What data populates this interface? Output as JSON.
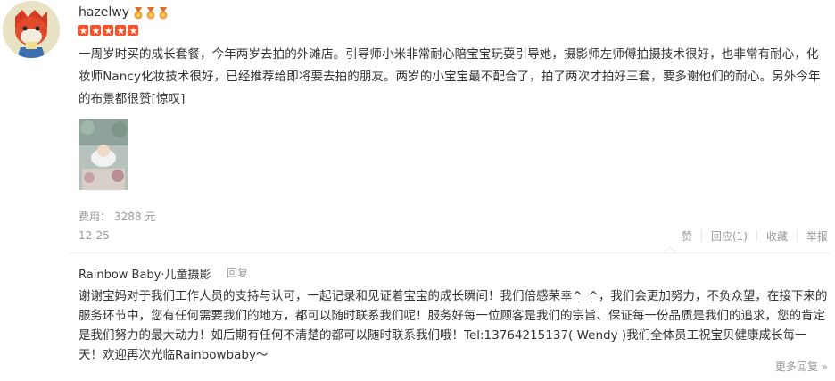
{
  "review": {
    "username": "hazelwy",
    "text": "一周岁时买的成长套餐，今年两岁去拍的外滩店。引导师小米非常耐心陪宝宝玩耍引导她，摄影师左师傅拍摄技术很好，也非常有耐心，化妆师Nancy化妆技术很好，已经推荐给即将要去拍的朋友。两岁的小宝宝最不配合了，拍了两次才拍好三套，要多谢他们的耐心。另外今年的布景都很赞[惊叹]",
    "price_label": "费用：",
    "price_value": "3288 元",
    "date": "12-25",
    "rating_stars": 5,
    "medal_count": 3
  },
  "actions": {
    "like": "赞",
    "reply": "回应(1)",
    "favorite": "收藏",
    "report": "举报"
  },
  "reply": {
    "author": "Rainbow Baby·儿童摄影",
    "tag": "回复",
    "text": "谢谢宝妈对于我们工作人员的支持与认可，一起记录和见证着宝宝的成长瞬间！我们倍感荣幸^_^，我们会更加努力，不负众望，在接下来的服务环节中，您有任何需要我们的地方，都可以随时联系我们呢！服务好每一位顾客是我们的宗旨、保证每一份品质是我们的追求，您的肯定是我们努力的最大动力！如后期有任何不清楚的都可以随时联系我们哦！Tel:13764215137( Wendy )我们全体员工祝宝贝健康成长每一天！欢迎再次光临Rainbowbaby～",
    "more": "更多回复 »"
  },
  "colors": {
    "star": "#f5522d",
    "medal": "#f0a030",
    "muted": "#999999"
  }
}
